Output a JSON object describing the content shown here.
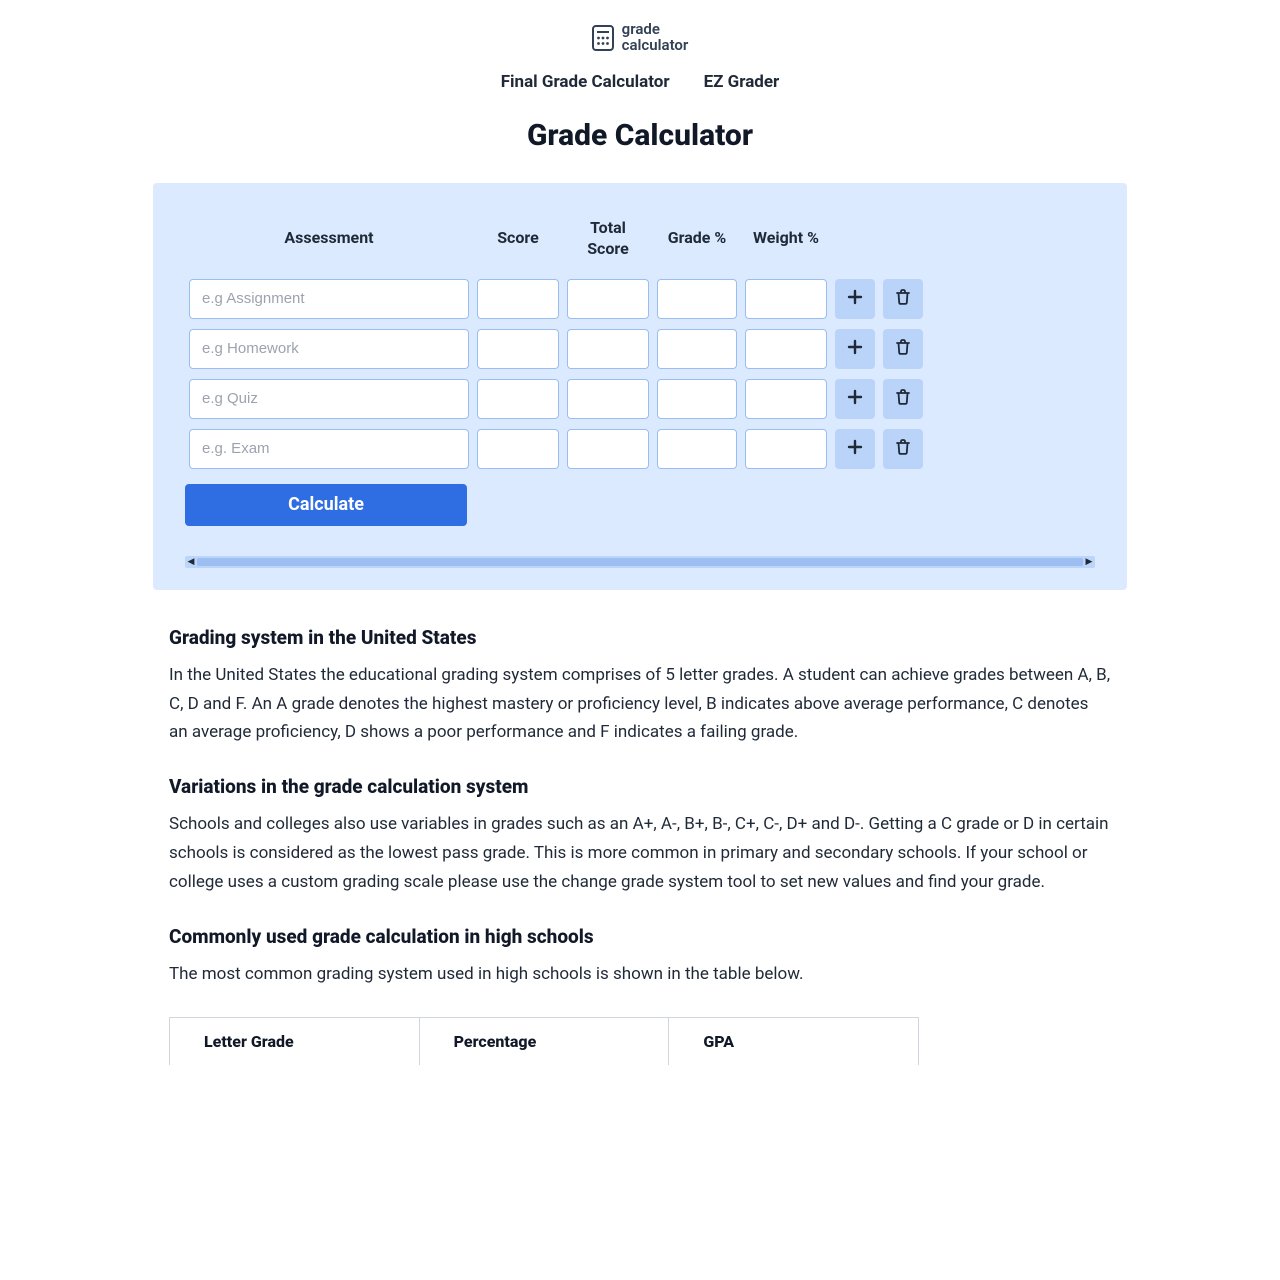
{
  "logo": {
    "line1": "grade",
    "line2": "calculator"
  },
  "nav": {
    "final_grade": "Final Grade Calculator",
    "ez_grader": "EZ Grader"
  },
  "title": "Grade Calculator",
  "table": {
    "headers": {
      "assessment": "Assessment",
      "score": "Score",
      "total_score": "Total Score",
      "grade_pct": "Grade %",
      "weight_pct": "Weight %"
    },
    "rows": [
      {
        "placeholder": "e.g Assignment"
      },
      {
        "placeholder": "e.g Homework"
      },
      {
        "placeholder": "e.g Quiz"
      },
      {
        "placeholder": "e.g. Exam"
      }
    ],
    "calculate_label": "Calculate"
  },
  "sections": {
    "s1_title": "Grading system in the United States",
    "s1_body": "In the United States the educational grading system comprises of 5 letter grades. A student can achieve grades between A, B, C, D and F. An A grade denotes the highest mastery or proficiency level, B indicates above average performance, C denotes an average proficiency, D shows a poor performance and F indicates a failing grade.",
    "s2_title": "Variations in the grade calculation system",
    "s2_body": "Schools and colleges also use variables in grades such as an A+, A-, B+, B-, C+, C-, D+ and D-. Getting a C grade or D in certain schools is considered as the lowest pass grade. This is more common in primary and secondary schools. If your school or college uses a custom grading scale please use the change grade system tool to set new values and find your grade.",
    "s3_title": "Commonly used grade calculation in high schools",
    "s3_body": "The most common grading system used in high schools is shown in the table below."
  },
  "grade_table": {
    "col1": "Letter Grade",
    "col2": "Percentage",
    "col3": "GPA"
  }
}
